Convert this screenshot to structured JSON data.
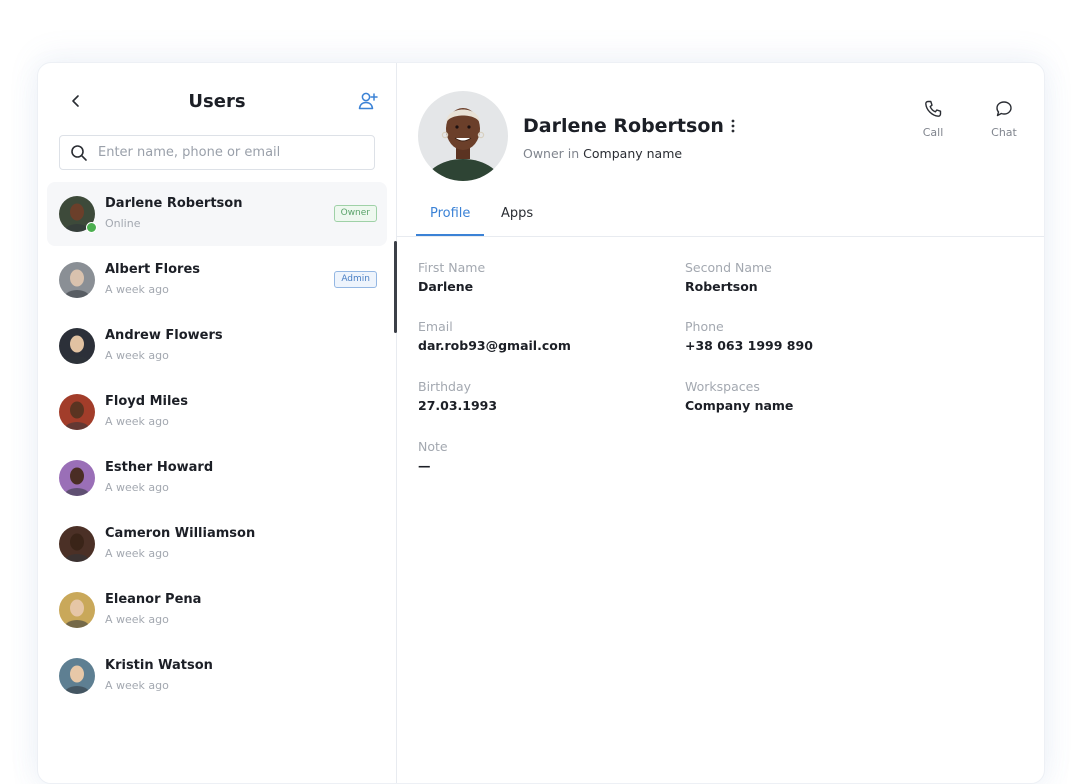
{
  "users_panel": {
    "title": "Users",
    "search_placeholder": "Enter name, phone or email",
    "users": [
      {
        "name": "Darlene Robertson",
        "status": "Online",
        "badge": "Owner",
        "avatar_color": "#3d4a3a",
        "skin": "#6b3f2a"
      },
      {
        "name": "Albert Flores",
        "status": "A week ago",
        "badge": "Admin",
        "avatar_color": "#8a8f95",
        "skin": "#d9c2ae"
      },
      {
        "name": "Andrew Flowers",
        "status": "A week ago",
        "badge": "",
        "avatar_color": "#2c3039",
        "skin": "#e1c2a2"
      },
      {
        "name": "Floyd Miles",
        "status": "A week ago",
        "badge": "",
        "avatar_color": "#a23d2a",
        "skin": "#5a3421"
      },
      {
        "name": "Esther Howard",
        "status": "A week ago",
        "badge": "",
        "avatar_color": "#9a6fb7",
        "skin": "#4a2d24"
      },
      {
        "name": "Cameron Williamson",
        "status": "A week ago",
        "badge": "",
        "avatar_color": "#4b3026",
        "skin": "#3a2418"
      },
      {
        "name": "Eleanor Pena",
        "status": "A week ago",
        "badge": "",
        "avatar_color": "#c9a85a",
        "skin": "#e6c6a6"
      },
      {
        "name": "Kristin Watson",
        "status": "A week ago",
        "badge": "",
        "avatar_color": "#5e7f92",
        "skin": "#e7c8a8"
      }
    ]
  },
  "profile": {
    "name": "Darlene Robertson",
    "role_prefix": "Owner in",
    "company": "Company name",
    "actions": {
      "call": "Call",
      "chat": "Chat"
    },
    "tabs": [
      "Profile",
      "Apps"
    ],
    "fields": {
      "first_name": {
        "label": "First Name",
        "value": "Darlene"
      },
      "second_name": {
        "label": "Second Name",
        "value": "Robertson"
      },
      "email": {
        "label": "Email",
        "value": "dar.rob93@gmail.com"
      },
      "phone": {
        "label": "Phone",
        "value": "+38 063 1999 890"
      },
      "birthday": {
        "label": "Birthday",
        "value": "27.03.1993"
      },
      "workspaces": {
        "label": "Workspaces",
        "value": "Company name"
      },
      "note": {
        "label": "Note",
        "value": "—"
      }
    }
  },
  "colors": {
    "accent": "#3b82d6",
    "online": "#4caf50",
    "owner_badge": "#5aa36a",
    "admin_badge": "#4a7fc4"
  }
}
